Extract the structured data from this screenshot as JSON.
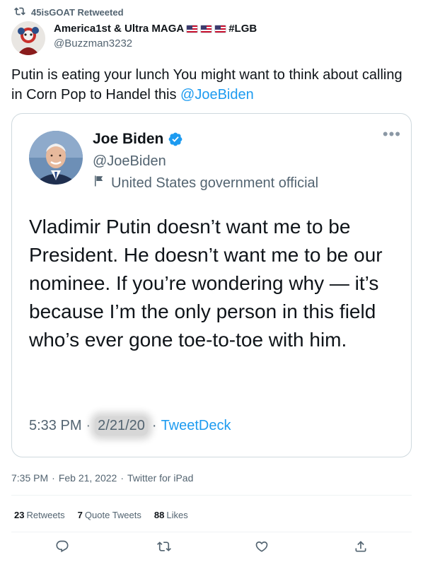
{
  "retweet_header": {
    "label": "45isGOAT Retweeted",
    "icon": "retweet-icon"
  },
  "author": {
    "display_name": "America1st & Ultra MAGA",
    "name_suffix": "#LGB",
    "flag_count": 3,
    "handle": "@Buzzman3232",
    "avatar_icon": "avatar-image"
  },
  "tweet": {
    "text": "Putin is eating your lunch You might want to think about calling in Corn Pop to Handel this ",
    "mention": "@JoeBiden"
  },
  "quoted_tweet": {
    "display_name": "Joe Biden",
    "verified_icon": "verified-badge-icon",
    "handle": "@JoeBiden",
    "label": "United States government official",
    "label_icon": "flag-icon",
    "more_icon": "more-dots-icon",
    "more_label": "•••",
    "text": "Vladimir Putin doesn’t want me to be President. He doesn’t want me to be our nominee. If you’re wondering why — it’s because I’m the only person in this field who’s ever gone toe-to-toe with him.",
    "time": "5:33 PM",
    "separator": "·",
    "date": "2/21/20",
    "source": "TweetDeck"
  },
  "tweet_meta": {
    "time": "7:35 PM",
    "date": "Feb 21, 2022",
    "source": "Twitter for iPad",
    "separator": "·"
  },
  "stats": {
    "retweets_count": "23",
    "retweets_label": "Retweets",
    "quote_count": "7",
    "quote_label": "Quote Tweets",
    "likes_count": "88",
    "likes_label": "Likes"
  },
  "actions": [
    "reply-icon",
    "retweet-icon",
    "like-icon",
    "share-icon"
  ],
  "colors": {
    "accent": "#1d9bf0",
    "secondary_text": "#536471",
    "border": "#cfd9de"
  }
}
